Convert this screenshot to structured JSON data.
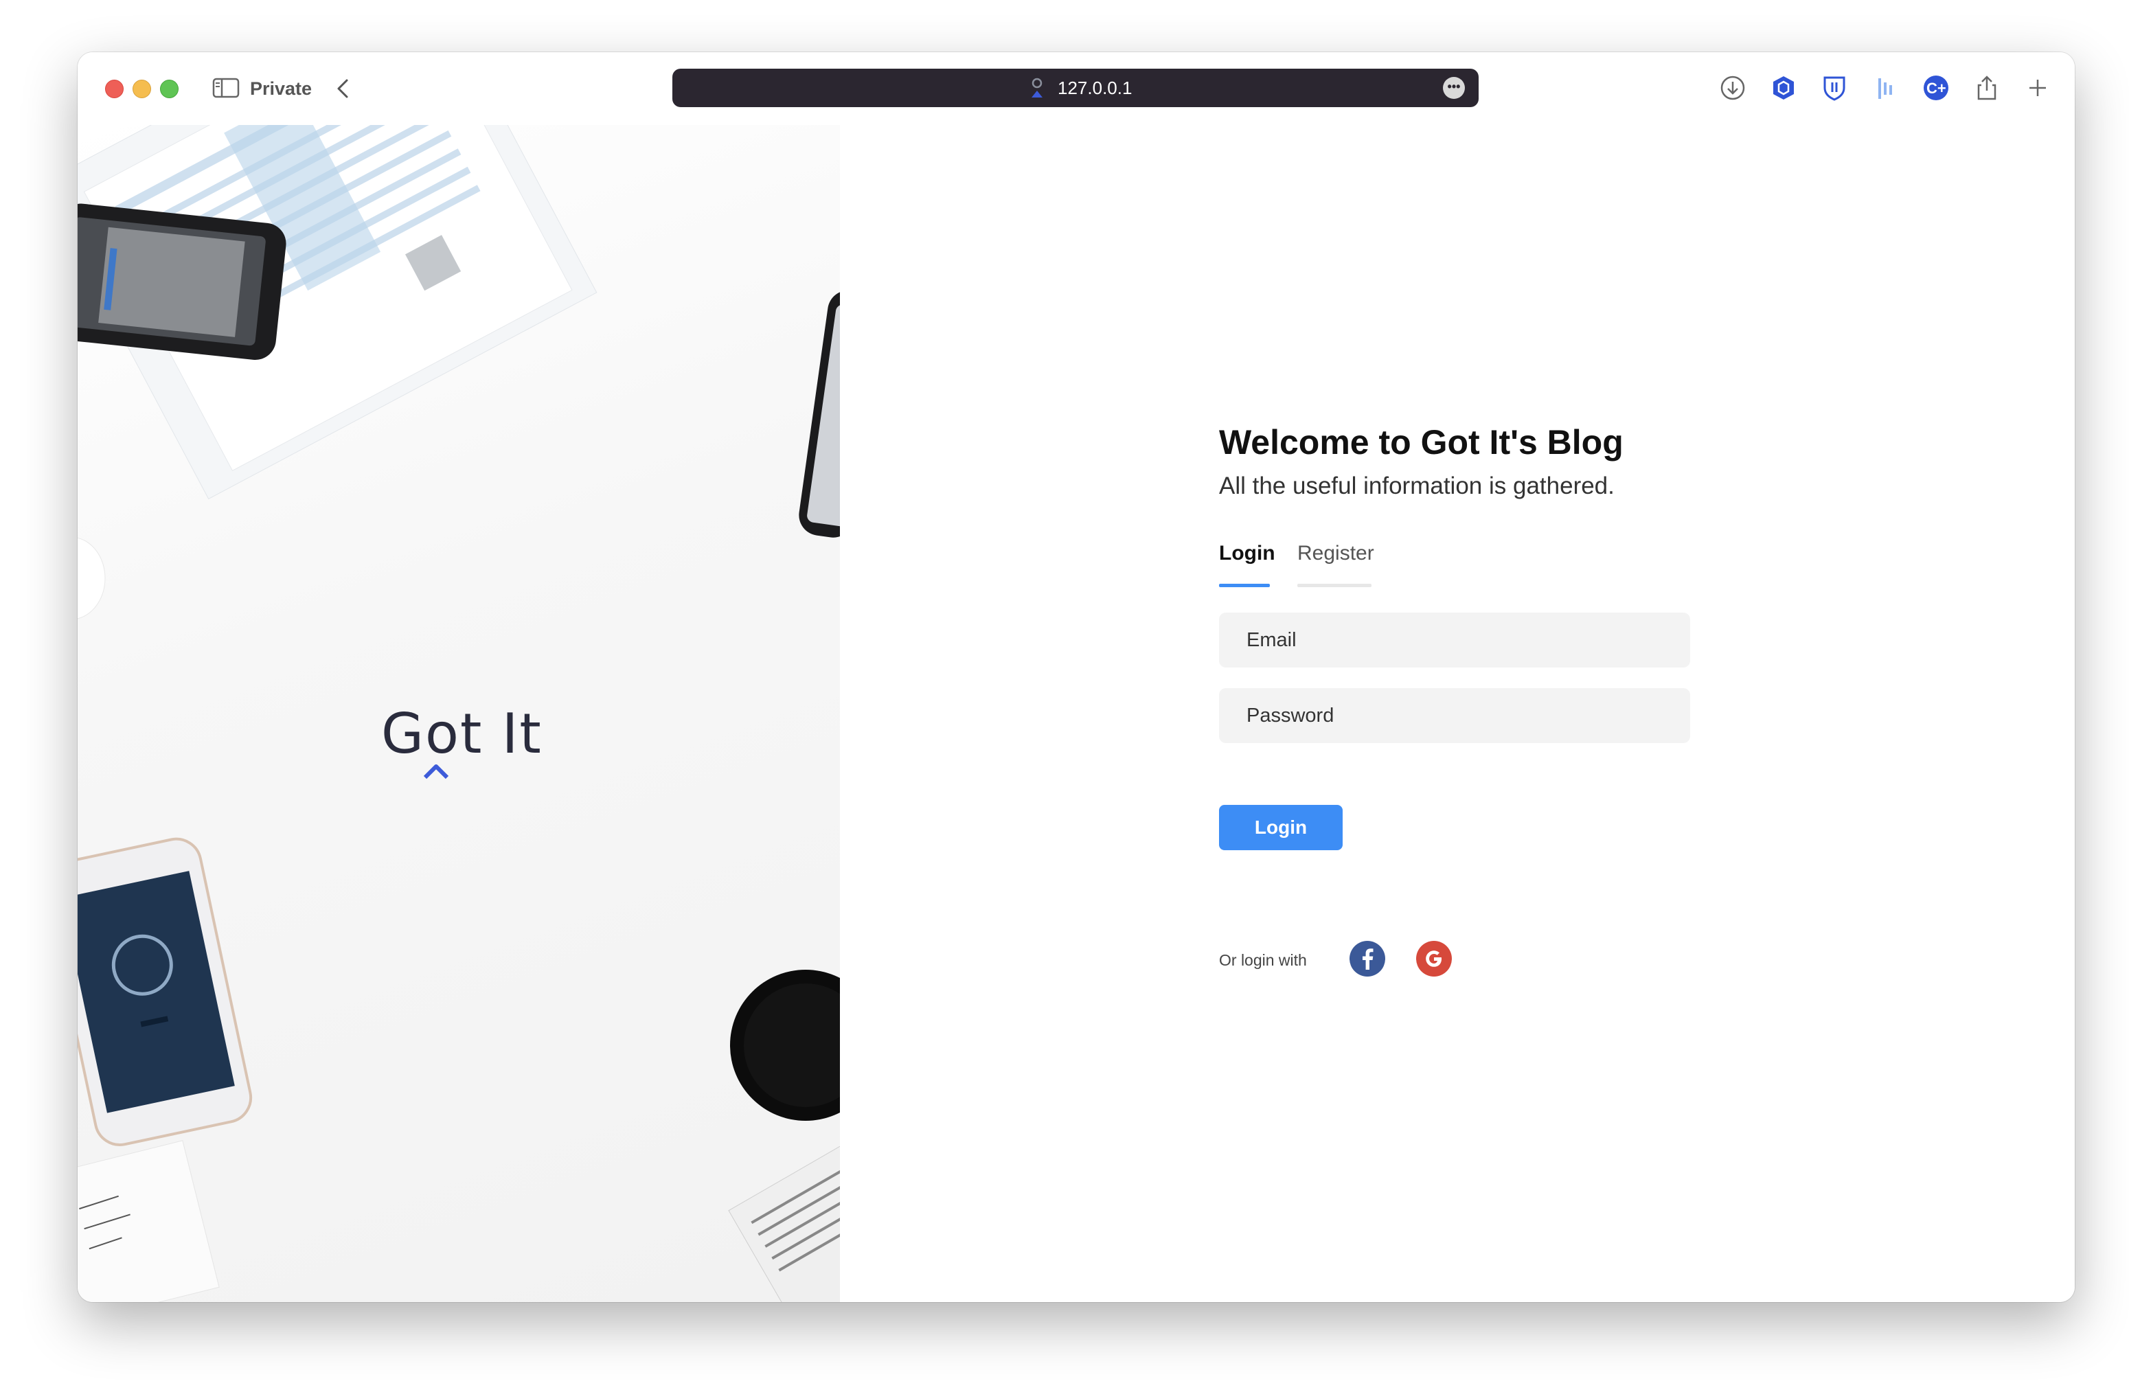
{
  "browser": {
    "private_label": "Private",
    "url": "127.0.0.1",
    "toolbar_icons": [
      "download-icon",
      "extension-hex-icon",
      "bitwarden-shield-icon",
      "extension-bars-icon",
      "extension-c-plus-icon",
      "share-icon",
      "new-tab-plus-icon"
    ]
  },
  "hero": {
    "logo_text": "Got It"
  },
  "form": {
    "title": "Welcome to Got It's Blog",
    "subtitle": "All the useful information is gathered.",
    "tabs": [
      {
        "label": "Login",
        "active": true
      },
      {
        "label": "Register",
        "active": false
      }
    ],
    "email_placeholder": "Email",
    "password_placeholder": "Password",
    "submit_label": "Login",
    "social_label": "Or login with",
    "social_providers": [
      "facebook-icon",
      "google-icon"
    ]
  },
  "colors": {
    "accent": "#3d8df5",
    "facebook": "#3b5998",
    "google": "#d6493b",
    "url_bar": "#2b2630"
  }
}
